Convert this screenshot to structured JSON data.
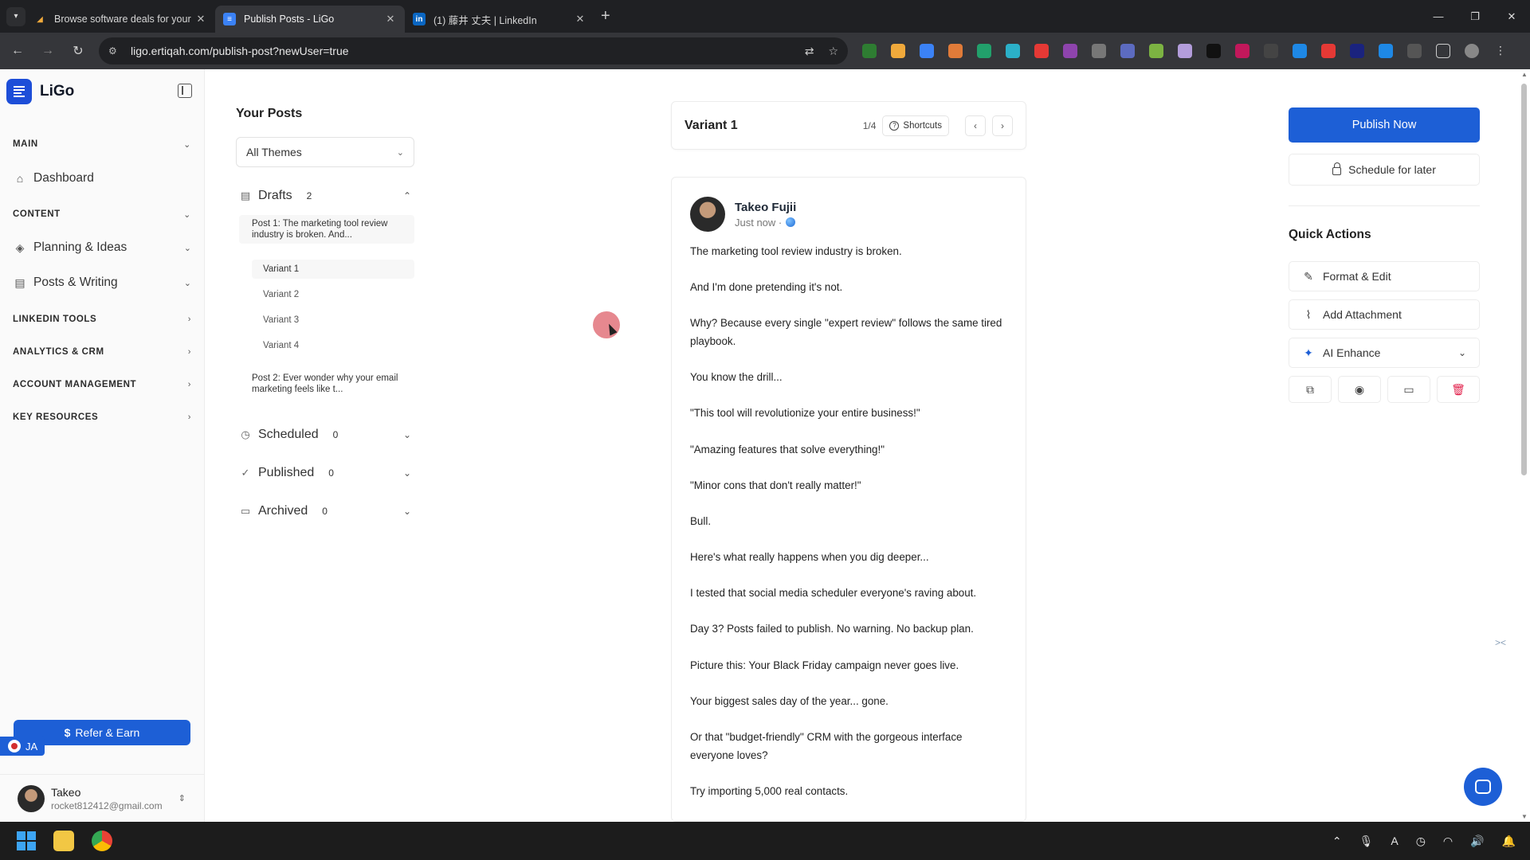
{
  "browser": {
    "tabs": [
      {
        "title": "Browse software deals for your",
        "icon": "deal-icon",
        "color": "#f0a93b"
      },
      {
        "title": "Publish Posts - LiGo",
        "icon": "ligo-icon",
        "color": "#3b82f6"
      },
      {
        "title": "(1) 藤井 丈夫 | LinkedIn",
        "icon": "linkedin-icon",
        "color": "#0a66c2"
      }
    ],
    "url": "ligo.ertiqah.com/publish-post?newUser=true"
  },
  "app": {
    "name": "LiGo",
    "brand_color": "#1d5fd6"
  },
  "sidebar": {
    "sections": {
      "main": "MAIN",
      "content": "CONTENT",
      "linkedin_tools": "LINKEDIN TOOLS",
      "analytics": "ANALYTICS & CRM",
      "account": "ACCOUNT MANAGEMENT",
      "resources": "KEY RESOURCES"
    },
    "items": {
      "dashboard": "Dashboard",
      "planning": "Planning & Ideas",
      "posts": "Posts & Writing"
    },
    "refer_label": "Refer & Earn",
    "lang_label": "JA",
    "user": {
      "name": "Takeo",
      "email": "rocket812412@gmail.com"
    }
  },
  "posts_panel": {
    "title": "Your Posts",
    "theme_filter": "All Themes",
    "groups": {
      "drafts": {
        "label": "Drafts",
        "count": "2"
      },
      "scheduled": {
        "label": "Scheduled",
        "count": "0"
      },
      "published": {
        "label": "Published",
        "count": "0"
      },
      "archived": {
        "label": "Archived",
        "count": "0"
      }
    },
    "draft_posts": [
      {
        "preview": "Post 1: The marketing tool review industry is broken. And..."
      },
      {
        "preview": "Post 2: Ever wonder why your email marketing feels like t..."
      }
    ],
    "variants": [
      "Variant 1",
      "Variant 2",
      "Variant 3",
      "Variant 4"
    ]
  },
  "editor": {
    "variant_name": "Variant 1",
    "variant_count": "1/4",
    "shortcuts_label": "Shortcuts",
    "author": "Takeo Fujii",
    "timestamp": "Just now ·",
    "lines": [
      "The marketing tool review industry is broken.",
      "And I'm done pretending it's not.",
      "Why? Because every single \"expert review\" follows the same tired playbook.",
      "You know the drill...",
      "\"This tool will revolutionize your entire business!\"",
      "\"Amazing features that solve everything!\"",
      "\"Minor cons that don't really matter!\"",
      "Bull.",
      "Here's what really happens when you dig deeper...",
      "I tested that social media scheduler everyone's raving about.",
      "Day 3? Posts failed to publish. No warning. No backup plan.",
      "Picture this: Your Black Friday campaign never goes live.",
      "Your biggest sales day of the year... gone.",
      "Or that \"budget-friendly\" CRM with the gorgeous interface everyone loves?",
      "Try importing 5,000 real contacts."
    ]
  },
  "right_panel": {
    "publish_now": "Publish Now",
    "schedule_later": "Schedule for later",
    "quick_actions_title": "Quick Actions",
    "format_edit": "Format & Edit",
    "add_attachment": "Add Attachment",
    "ai_enhance": "AI Enhance"
  }
}
